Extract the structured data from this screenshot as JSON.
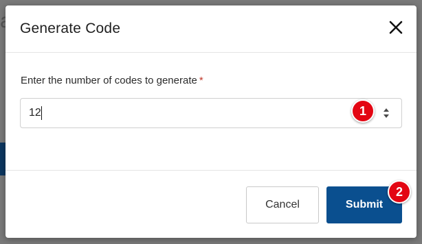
{
  "dialog": {
    "title": "Generate Code",
    "close_icon": "close-icon"
  },
  "form": {
    "label": "Enter the number of codes to generate",
    "required_marker": "*",
    "value": "12",
    "stepper_icon": "number-stepper-icon"
  },
  "footer": {
    "cancel_label": "Cancel",
    "submit_label": "Submit"
  },
  "annotations": [
    {
      "label": "1"
    },
    {
      "label": "2"
    }
  ],
  "colors": {
    "primary": "#0a4f8f",
    "annotation": "#e30613",
    "required": "#c0392b"
  }
}
